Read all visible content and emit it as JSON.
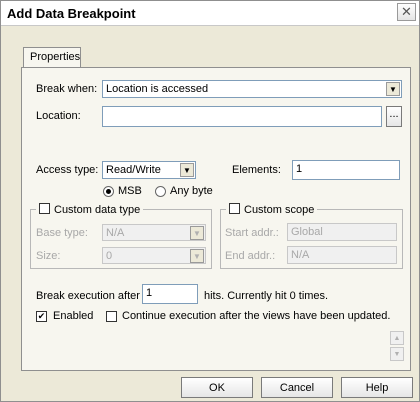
{
  "window": {
    "title": "Add Data Breakpoint",
    "close_icon": "close-icon"
  },
  "tabs": [
    {
      "label": "Properties"
    }
  ],
  "break_when": {
    "label": "Break when:",
    "value": "Location is accessed"
  },
  "location": {
    "label": "Location:",
    "value": "",
    "browse_label": "..."
  },
  "access_type": {
    "label": "Access type:",
    "value": "Read/Write",
    "msb_label": "MSB",
    "any_byte_label": "Any byte",
    "selected": "MSB"
  },
  "elements": {
    "label": "Elements:",
    "value": "1"
  },
  "custom_data_type": {
    "label": "Custom data type",
    "checked": false,
    "base_type_label": "Base type:",
    "base_type_value": "N/A",
    "size_label": "Size:",
    "size_value": "0"
  },
  "custom_scope": {
    "label": "Custom scope",
    "checked": false,
    "start_addr_label": "Start addr.:",
    "start_addr_value": "Global",
    "end_addr_label": "End addr.:",
    "end_addr_value": "N/A"
  },
  "break_after": {
    "label": "Break execution after",
    "value": "1",
    "hits_text": "hits. Currently hit 0 times."
  },
  "enabled": {
    "label": "Enabled",
    "checked": true
  },
  "continue_execution": {
    "label": "Continue execution after the views have been updated.",
    "checked": false
  },
  "buttons": {
    "ok": "OK",
    "cancel": "Cancel",
    "help": "Help"
  }
}
